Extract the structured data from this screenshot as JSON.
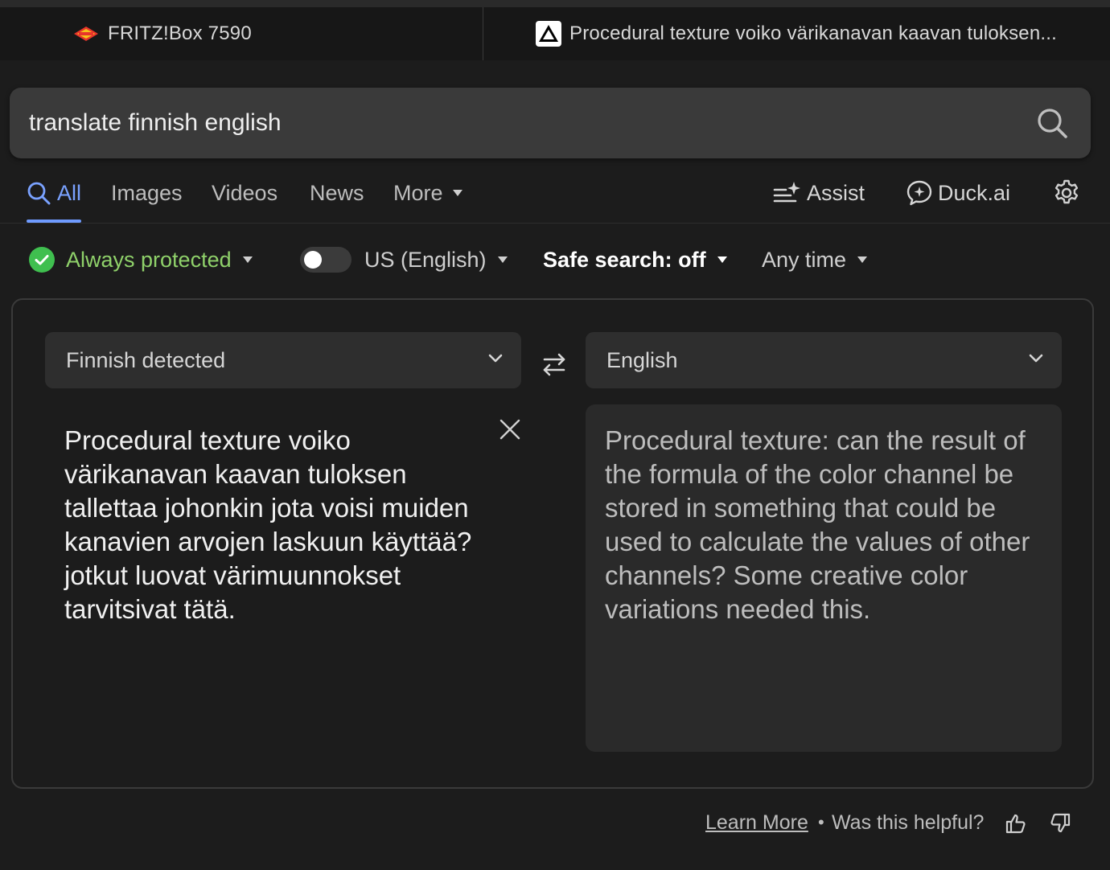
{
  "tabs": [
    {
      "title": "FRITZ!Box 7590",
      "icon": "fritz-logo-icon"
    },
    {
      "title": "Procedural texture voiko värikanavan kaavan tuloksen...",
      "icon": "warning-triangle-icon"
    }
  ],
  "search": {
    "value": "translate finnish english"
  },
  "nav": {
    "all": "All",
    "images": "Images",
    "videos": "Videos",
    "news": "News",
    "more": "More",
    "assist": "Assist",
    "duckai": "Duck.ai"
  },
  "filters": {
    "protected": "Always protected",
    "region": "US (English)",
    "safesearch": "Safe search: off",
    "time": "Any time"
  },
  "translator": {
    "source_lang": "Finnish detected",
    "target_lang": "English",
    "source_text": "Procedural texture voiko värikanavan kaavan tuloksen tallettaa johonkin jota voisi muiden kanavien arvojen laskuun käyttää? jotkut luovat värimuunnokset tarvitsivat tätä.",
    "output_text": "Procedural texture: can the result of the formula of the color channel be stored in something that could be used to calculate the values of other channels? Some creative color variations needed this."
  },
  "footer": {
    "learn_more": "Learn More",
    "separator": "•",
    "helpful": "Was this helpful?"
  },
  "colors": {
    "accent": "#7aa2ff",
    "protected_green": "#8fd16a",
    "check_green": "#3fbf4f"
  }
}
